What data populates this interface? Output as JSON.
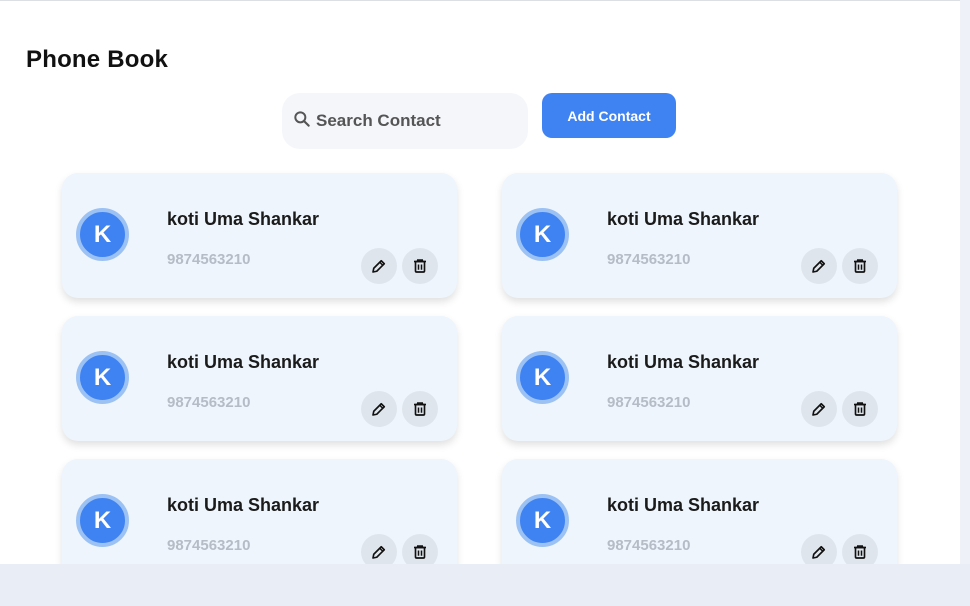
{
  "page": {
    "title": "Phone Book"
  },
  "search": {
    "placeholder": "Search Contact",
    "value": ""
  },
  "toolbar": {
    "add_label": "Add Contact"
  },
  "contacts": [
    {
      "initial": "K",
      "name": "koti Uma Shankar",
      "phone": "9874563210"
    },
    {
      "initial": "K",
      "name": "koti Uma Shankar",
      "phone": "9874563210"
    },
    {
      "initial": "K",
      "name": "koti Uma Shankar",
      "phone": "9874563210"
    },
    {
      "initial": "K",
      "name": "koti Uma Shankar",
      "phone": "9874563210"
    },
    {
      "initial": "K",
      "name": "koti Uma Shankar",
      "phone": "9874563210"
    },
    {
      "initial": "K",
      "name": "koti Uma Shankar",
      "phone": "9874563210"
    }
  ],
  "icons": {
    "search": "search-icon",
    "edit": "pencil-icon",
    "delete": "trash-icon"
  },
  "colors": {
    "accent": "#3f83f3",
    "card_bg": "#eef5fd",
    "avatar_ring": "#9cc2f4",
    "phone_text": "#b5bcc6"
  }
}
